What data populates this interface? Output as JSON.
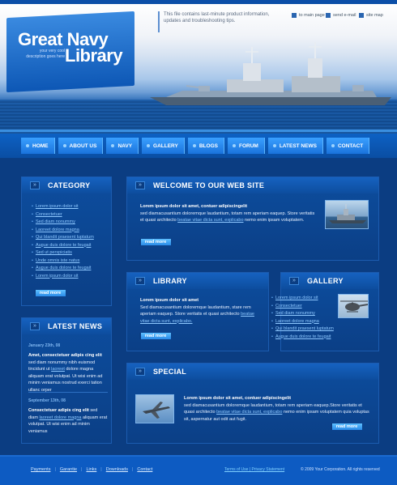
{
  "header": {
    "logo_line1": "Great Navy",
    "logo_line2": "Library",
    "logo_tagline": "your very cool description goes here",
    "info_text": "This file contains last-minute product information, updates and troubleshooting tips.",
    "top_links": [
      {
        "label": "to main page",
        "icon": "home-icon"
      },
      {
        "label": "send e-mail",
        "icon": "mail-icon"
      },
      {
        "label": "site map",
        "icon": "sitemap-icon"
      }
    ]
  },
  "nav": {
    "items": [
      "HOME",
      "ABOUT US",
      "NAVY",
      "GALLERY",
      "BLOGS",
      "FORUM",
      "LATEST NEWS",
      "CONTACT"
    ]
  },
  "category": {
    "title": "CATEGORY",
    "items": [
      "Lorem ipsum dolor sit",
      "Consectetuer",
      "Sed diam nonummy",
      "Laoreet dolore magna",
      "Qui blandit praesent luptatum",
      "Augue duis dolore te feugait",
      "Sed ut perspiciatis",
      "Unde omnis iste natus",
      "Augue duis dolore te feugait",
      "Lorem ipsum dolor sit"
    ],
    "more": "read more"
  },
  "latest_news": {
    "title": "LATEST NEWS",
    "news": [
      {
        "date": "January 23th, 08",
        "lead": "Amet, consectetuer adipis cing elit",
        "body1": " sed diam nonummy nibh euismod tincidunt ut",
        "link": "laoreet",
        "body2": " dolore magna aliquam erat volutpat.  Ut wisi enim ad minim veniamus nostrud exerci tation ullanc orper"
      },
      {
        "date": "September 13th, 08",
        "lead": "Consectetuer adipis cing elit",
        "body1": " sed diam ",
        "link": "laoreet dolore magna",
        "body2": " aliquam erat volutpat.  Ut wisi enim ad minim veniamus"
      }
    ]
  },
  "welcome": {
    "title": "WELCOME TO OUR WEB SITE",
    "lead": "Lorem ipsum dolor sit amet, contuer adipiscingelit",
    "body1": "sed diamacusantium doloremque laudantium, totam rem aperiam eaquep. Store veritatis et quasi architecto ",
    "link": "beatae vitae dicta sunt, explicabo",
    "body2": " nemo enim ipsam voluptatem.",
    "more": "read more"
  },
  "library": {
    "title": "LIBRARY",
    "lead": "Lorem ipsum dolor sit amet",
    "body1": "Sed diamacusantium doloremque laudantium, stare rem aperiam eaquep. Store veritatis et quasi architecto ",
    "link": "beatae vitae dicta sunt, explicabo.",
    "more": "read more"
  },
  "gallery": {
    "title": "GALLERY",
    "items": [
      "Lorem ipsum dolor sit",
      "Consectetuer",
      "Sed diam nonummy",
      "Laoreet dolore magna",
      "Qui blandit praesent luptatum",
      "Augue duis dolore te feugait"
    ]
  },
  "special": {
    "title": "SPECIAL",
    "lead": "Lorem ipsum dolor sit amet, contuer adipiscingelit",
    "body1": "sed diamacusantium doloremque laudantium, totam rem aperiam eaquep.Store veritatis et quasi architecto ",
    "link": "beatae vitae dicta sunt, explicabo",
    "body2": " nemo enim ipsam voluptatem quia voluptas sit, aspernatur aut odit aut fugit.",
    "more": "read more"
  },
  "footer": {
    "links": [
      "Payments",
      "Garantie",
      "Links",
      "Downloads",
      "Contact"
    ],
    "legal": "Terms of Use | Privacy Statement",
    "copyright": "© 2009 Your Corporation.  All rights reserved"
  },
  "colors": {
    "accent": "#1a73dc",
    "link": "#8ec8ff",
    "background": "#0b3d82"
  }
}
